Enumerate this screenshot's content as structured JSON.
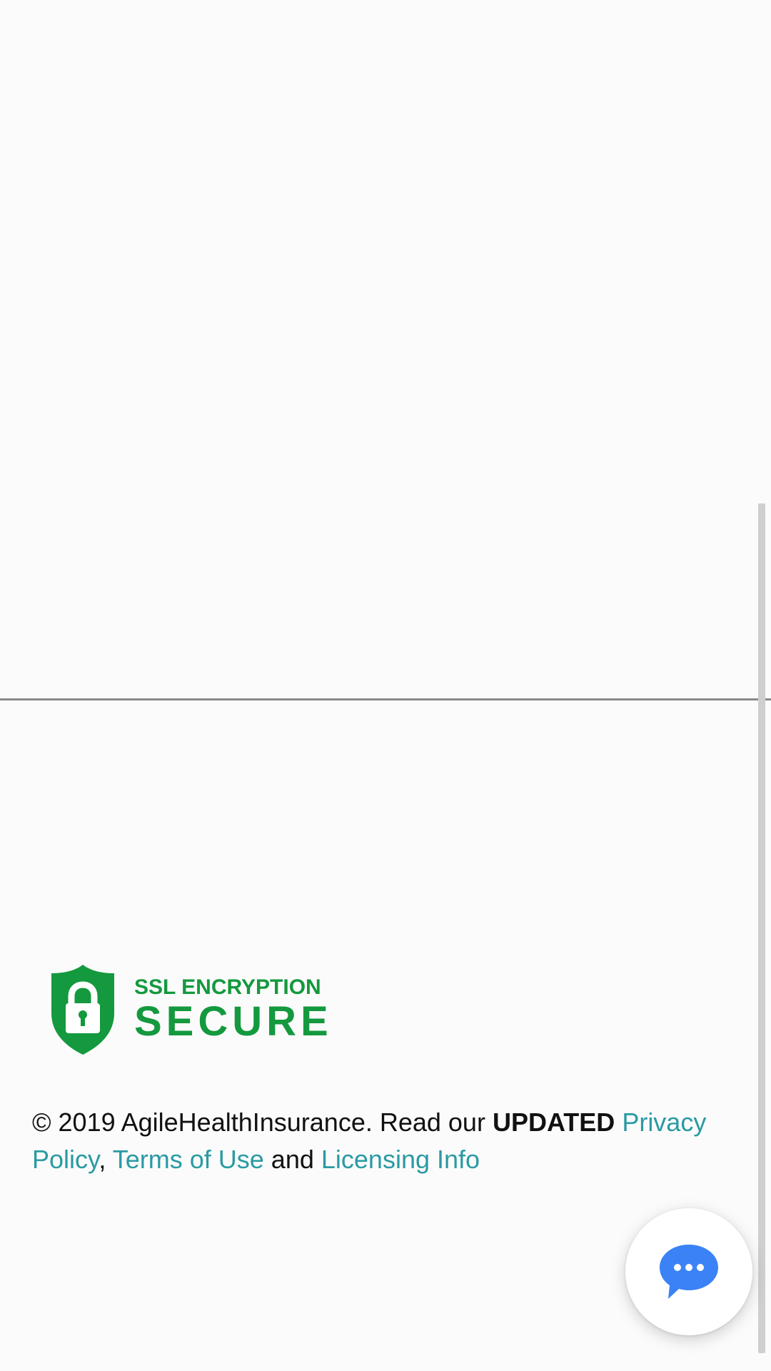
{
  "security_badge": {
    "line1": "SSL ENCRYPTION",
    "line2": "SECURE",
    "color": "#14993e",
    "icon": "shield-lock-icon"
  },
  "footer": {
    "copyright_prefix": "© 2019 AgileHealthInsurance. Read our ",
    "updated_label": "UPDATED",
    "privacy_link": "Privacy Policy",
    "comma": ",",
    "terms_link": "Terms of Use",
    "and_text": "and",
    "licensing_link": "Licensing Info",
    "link_color": "#2a9aa3"
  },
  "chat": {
    "icon": "chat-bubble-icon",
    "accent_color": "#3b82f6"
  }
}
